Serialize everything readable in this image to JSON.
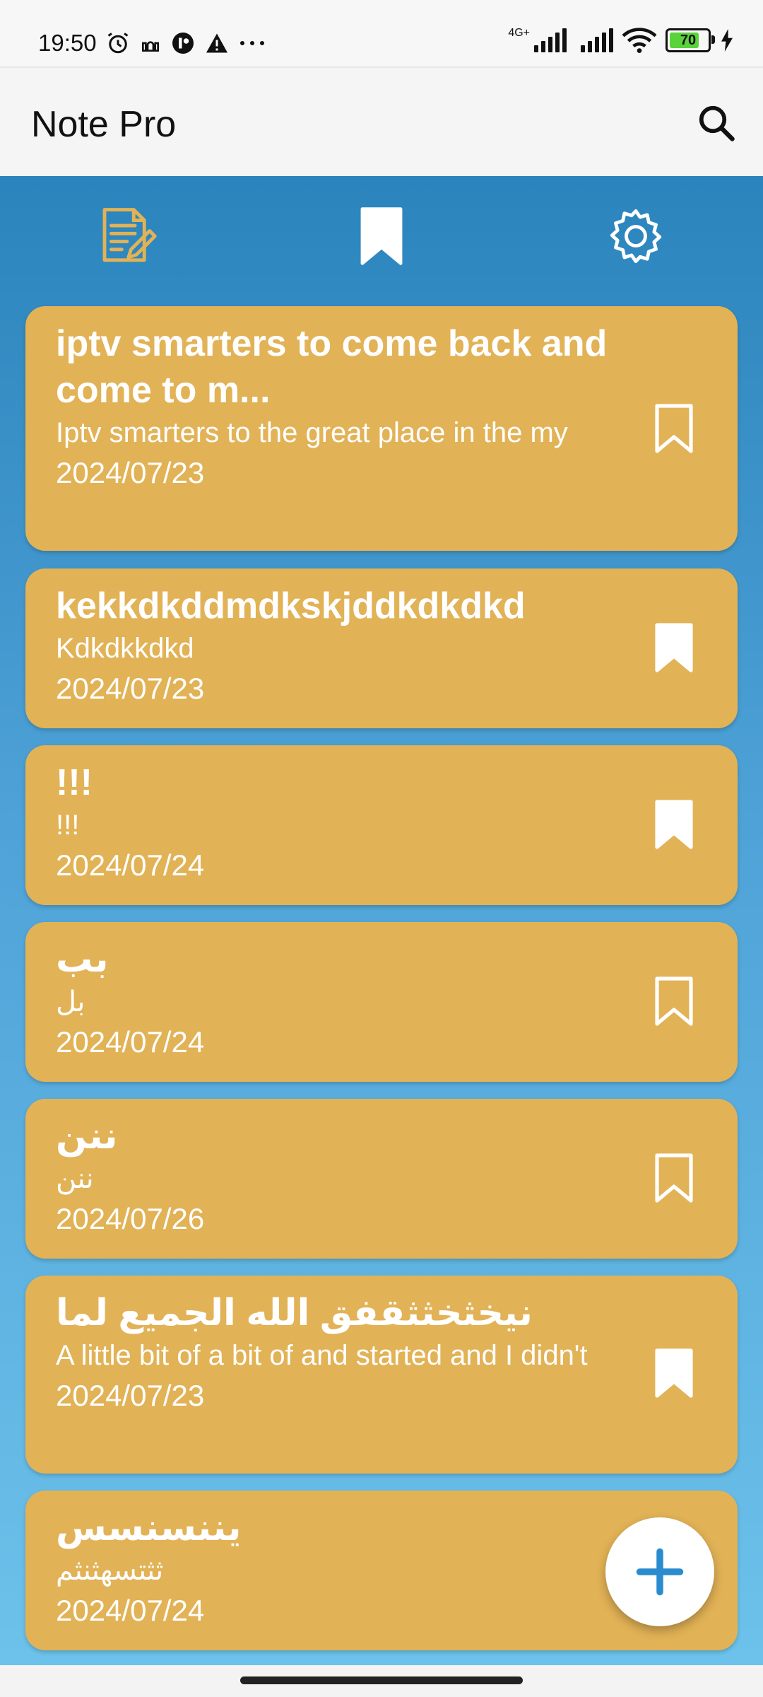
{
  "status_bar": {
    "time": "19:50",
    "network": "4G+",
    "battery": "70"
  },
  "app_bar": {
    "title": "Note Pro"
  },
  "tabs": [
    {
      "name": "notes",
      "icon": "note-edit-icon"
    },
    {
      "name": "bookmarks",
      "icon": "bookmark-icon",
      "active": true
    },
    {
      "name": "settings",
      "icon": "gear-icon"
    }
  ],
  "notes": [
    {
      "title": "iptv smarters to come back and come to m...",
      "body": "Iptv smarters to the great place in the my",
      "date": "2024/07/23",
      "bookmarked": false
    },
    {
      "title": "kekkdkddmdkskjddkdkdkd",
      "body": "Kdkdkkdkd",
      "date": "2024/07/23",
      "bookmarked": true
    },
    {
      "title": "!!!",
      "body": "!!!",
      "date": "2024/07/24",
      "bookmarked": true
    },
    {
      "title": "بب",
      "body": "بل",
      "date": "2024/07/24",
      "bookmarked": false
    },
    {
      "title": "ننن",
      "body": "ننن",
      "date": "2024/07/26",
      "bookmarked": false
    },
    {
      "title": "نيخثخثثقفق الله الجميع لما",
      "body": "A little bit of a bit of and started and I didn't",
      "date": "2024/07/23",
      "bookmarked": true
    },
    {
      "title": "يننسنسس",
      "body": "ثثتسهثنثم",
      "date": "2024/07/24",
      "bookmarked": null
    }
  ],
  "colors": {
    "card": "#e2b256",
    "accent": "#2a8ccf",
    "tab_active": "#ffffff",
    "tab_notes": "#e2b256"
  }
}
